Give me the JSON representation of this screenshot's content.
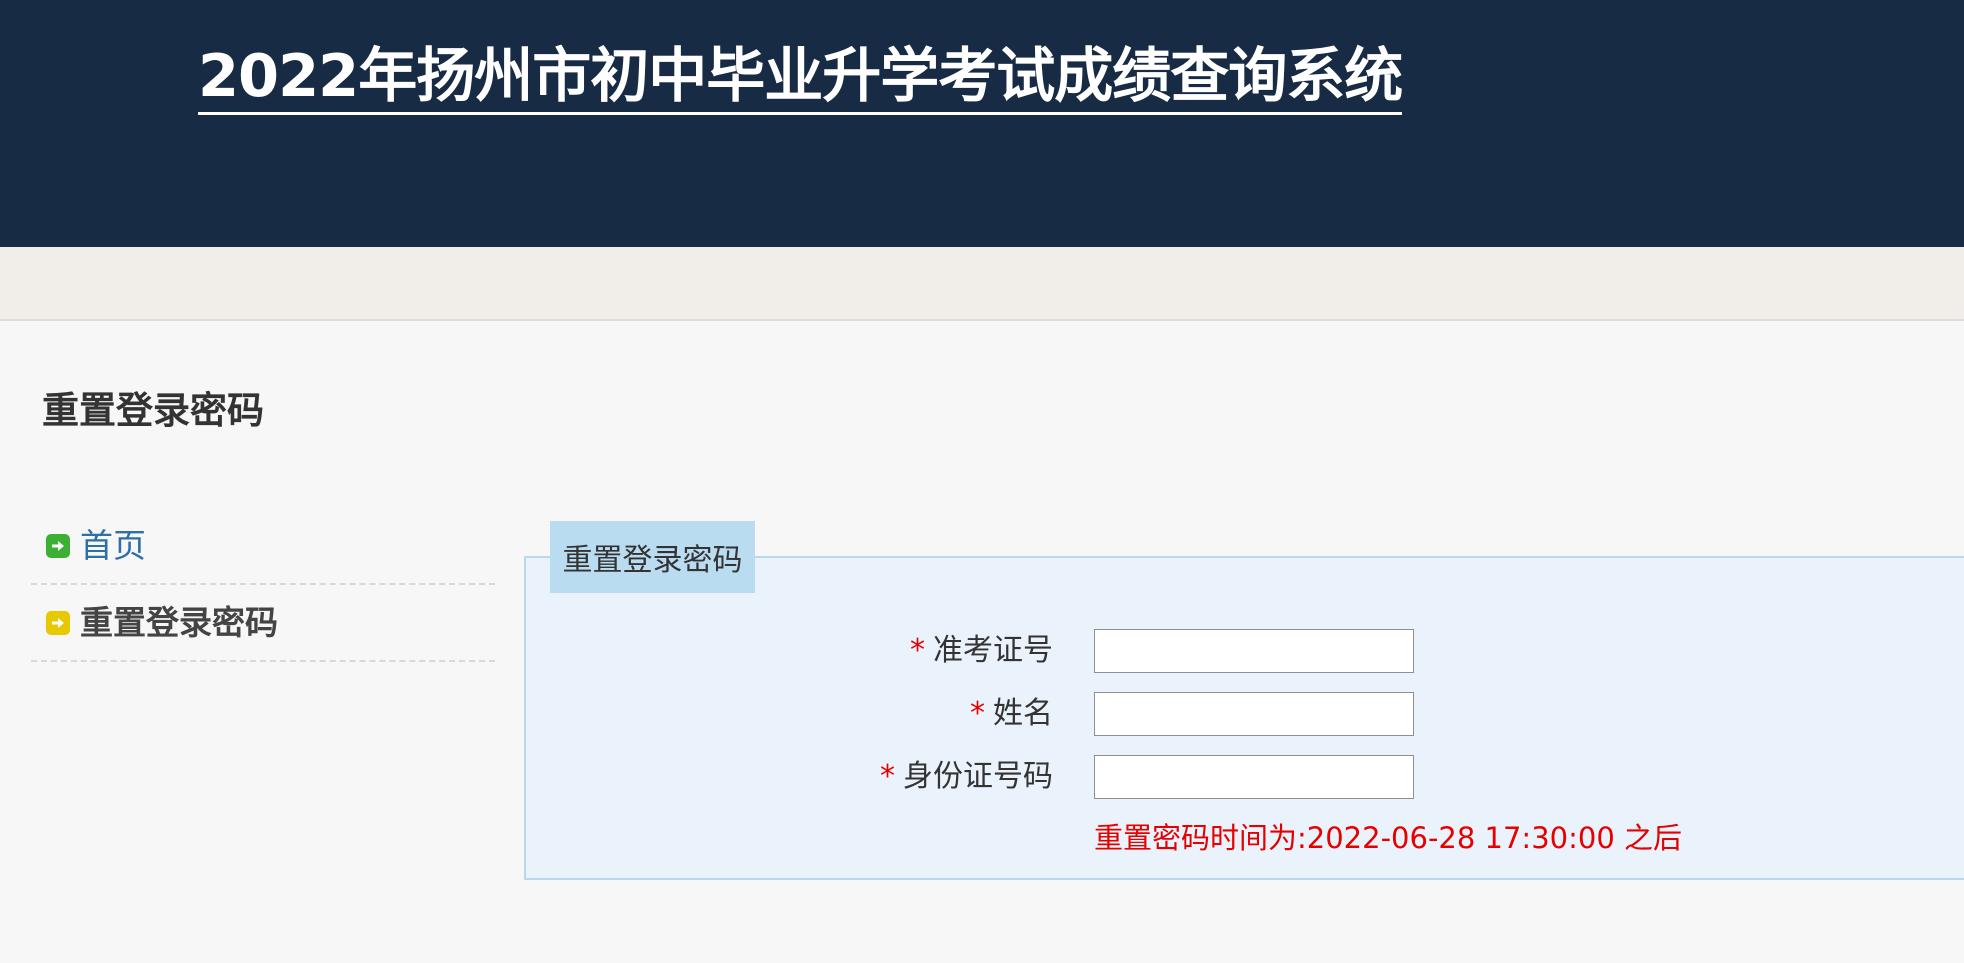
{
  "header": {
    "site_title": "2022年扬州市初中毕业升学考试成绩查询系统"
  },
  "page": {
    "title": "重置登录密码"
  },
  "sidebar": {
    "items": [
      {
        "label": "首页",
        "icon": "arrow-right-icon",
        "icon_color": "#3cb033",
        "active": false
      },
      {
        "label": "重置登录密码",
        "icon": "arrow-right-icon",
        "icon_color": "#e8c800",
        "active": true
      }
    ]
  },
  "form": {
    "tab_label": "重置登录密码",
    "required_mark": "*",
    "fields": [
      {
        "label": "准考证号",
        "value": ""
      },
      {
        "label": "姓名",
        "value": ""
      },
      {
        "label": "身份证号码",
        "value": ""
      }
    ],
    "notice": "重置密码时间为:2022-06-28 17:30:00 之后"
  },
  "colors": {
    "header_bg": "#182b45",
    "link": "#2f6fa7",
    "required": "#e60000",
    "panel_bg": "#eaf3fb",
    "tab_bg": "#b9dcf1"
  }
}
